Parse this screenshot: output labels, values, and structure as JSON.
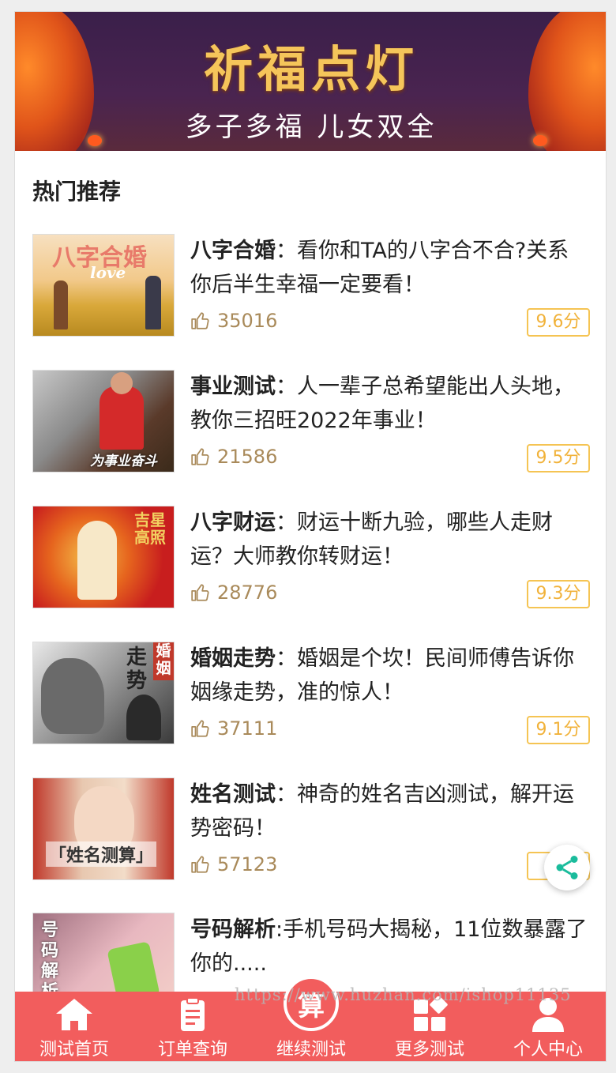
{
  "banner": {
    "title": "祈福点灯",
    "subtitle": "多子多福  儿女双全"
  },
  "section_title": "热门推荐",
  "items": [
    {
      "name": "八字合婚",
      "desc": "：看你和TA的八字合不合?关系你后半生幸福一定要看！",
      "likes": "35016",
      "score": "9.6分",
      "thumb_caption": "八字合婚",
      "thumb_sub": "love"
    },
    {
      "name": "事业测试",
      "desc": "：人一辈子总希望能出人头地，教你三招旺2022年事业！",
      "likes": "21586",
      "score": "9.5分",
      "thumb_caption": "为事业奋斗"
    },
    {
      "name": "八字财运",
      "desc": "：财运十断九验，哪些人走财运？大师教你转财运！",
      "likes": "28776",
      "score": "9.3分",
      "thumb_caption": "吉星高照"
    },
    {
      "name": "婚姻走势",
      "desc": "：婚姻是个坎！民间师傅告诉你姻缘走势，准的惊人！",
      "likes": "37111",
      "score": "9.1分",
      "thumb_caption": "走势",
      "thumb_sub": "婚姻"
    },
    {
      "name": "姓名测试",
      "desc": "：神奇的姓名吉凶测试，解开运势密码！",
      "likes": "57123",
      "score": "9",
      "thumb_caption": "「姓名测算」"
    },
    {
      "name": "号码解析",
      "desc": ":手机号码大揭秘，11位数暴露了你的.....",
      "thumb_caption": "号码解析"
    }
  ],
  "watermark": "https://www.huzhan.com/ishop11135",
  "tabbar": [
    {
      "label": "测试首页",
      "icon": "home-icon"
    },
    {
      "label": "订单查询",
      "icon": "clipboard-icon"
    },
    {
      "label": "继续测试",
      "icon": "suan-icon",
      "glyph": "算"
    },
    {
      "label": "更多测试",
      "icon": "grid-icon"
    },
    {
      "label": "个人中心",
      "icon": "user-icon"
    }
  ],
  "colors": {
    "tabbar": "#f25d5d",
    "score_border": "#f5c453",
    "likes": "#a98a5a",
    "share": "#1abc9c"
  }
}
